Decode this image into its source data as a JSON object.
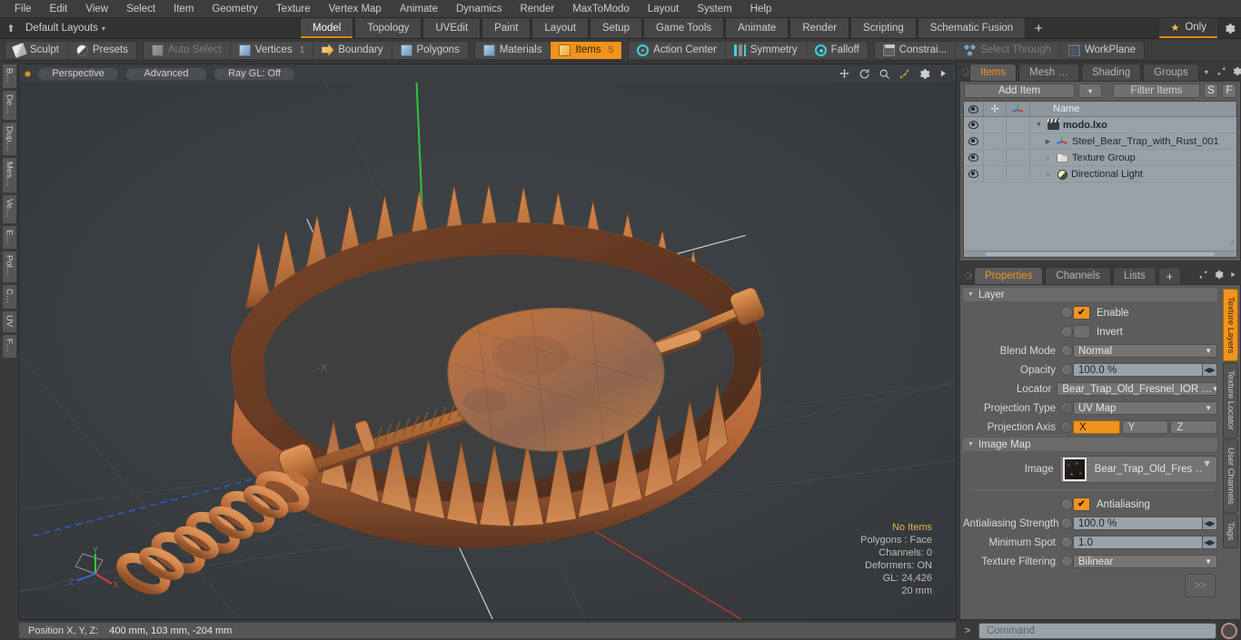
{
  "menubar": {
    "items": [
      "File",
      "Edit",
      "View",
      "Select",
      "Item",
      "Geometry",
      "Texture",
      "Vertex Map",
      "Animate",
      "Dynamics",
      "Render",
      "MaxToModo",
      "Layout",
      "System",
      "Help"
    ]
  },
  "layoutbar": {
    "layouts_label": "Default Layouts",
    "caret": "▾",
    "tabs": [
      {
        "label": "Model",
        "active": true
      },
      {
        "label": "Topology",
        "active": false
      },
      {
        "label": "UVEdit",
        "active": false
      },
      {
        "label": "Paint",
        "active": false
      },
      {
        "label": "Layout",
        "active": false
      },
      {
        "label": "Setup",
        "active": false
      },
      {
        "label": "Game Tools",
        "active": false
      },
      {
        "label": "Animate",
        "active": false
      },
      {
        "label": "Render",
        "active": false
      },
      {
        "label": "Scripting",
        "active": false
      },
      {
        "label": "Schematic Fusion",
        "active": false
      }
    ],
    "add_tab": "+",
    "only_label": "Only",
    "star": "★",
    "gear": "✷"
  },
  "modebar": {
    "group1": [
      {
        "label": "Sculpt",
        "icon": "pen-icon",
        "state": "normal",
        "count": ""
      },
      {
        "label": "Presets",
        "icon": "sphere-icon",
        "state": "normal",
        "count": ""
      }
    ],
    "group2": [
      {
        "label": "Auto Select",
        "icon": "cube-grey-icon",
        "state": "dim",
        "count": ""
      },
      {
        "label": "Vertices",
        "icon": "cube-icon",
        "state": "normal",
        "count": "1"
      },
      {
        "label": "Boundary",
        "icon": "arrow-icon",
        "state": "normal",
        "count": ""
      },
      {
        "label": "Polygons",
        "icon": "cube-icon",
        "state": "normal",
        "count": ""
      }
    ],
    "group3": [
      {
        "label": "Materials",
        "icon": "cube-icon",
        "state": "normal",
        "count": ""
      },
      {
        "label": "Items",
        "icon": "cube-gold-icon",
        "state": "selected",
        "count": "5"
      }
    ],
    "group4": [
      {
        "label": "Action Center",
        "icon": "target-icon",
        "state": "normal",
        "count": ""
      },
      {
        "label": "Symmetry",
        "icon": "symmetry-icon",
        "state": "normal",
        "count": ""
      },
      {
        "label": "Falloff",
        "icon": "falloff-icon",
        "state": "normal",
        "count": ""
      }
    ],
    "group5": [
      {
        "label": "Constrai...",
        "icon": "constrain-icon",
        "state": "normal",
        "count": ""
      },
      {
        "label": "Select Through",
        "icon": "select-through-icon",
        "state": "dim",
        "count": ""
      },
      {
        "label": "WorkPlane",
        "icon": "workplane-icon",
        "state": "normal",
        "count": ""
      }
    ]
  },
  "left_tabs": [
    "B…",
    "De…",
    "Dup…",
    "Mes…",
    "Ve…",
    "E…",
    "Pol…",
    "C…",
    "UV",
    "F…"
  ],
  "viewport": {
    "buttons": [
      "Perspective",
      "Advanced",
      "Ray GL: Off"
    ],
    "icons": [
      "move-icon",
      "rotate-icon",
      "zoom-icon",
      "maximize-icon",
      "gear-icon",
      "play-icon"
    ],
    "info": {
      "selection": "No Items",
      "polygons": "Polygons : Face",
      "channels": "Channels: 0",
      "deformers": "Deformers: ON",
      "gl": "GL: 24,426",
      "scale": "20 mm"
    },
    "gizmo_axes": [
      "X",
      "Y",
      "Z"
    ]
  },
  "statusbar": {
    "position_label": "Position X, Y, Z:",
    "position_value": "400 mm, 103 mm, -204 mm"
  },
  "items_panel": {
    "tabs": [
      {
        "label": "Items",
        "active": true
      },
      {
        "label": "Mesh …",
        "active": false
      },
      {
        "label": "Shading",
        "active": false
      },
      {
        "label": "Groups",
        "active": false
      }
    ],
    "tab_caret": "▾",
    "toolbar": {
      "add_item": "Add Item",
      "add_item_caret": "▾",
      "filter": "Filter Items",
      "btn_s": "S",
      "btn_f": "F"
    },
    "columns": {
      "eye": "eye-icon",
      "add": "+",
      "axis": "axis-icon",
      "name": "Name"
    },
    "rows": [
      {
        "name": "modo.lxo",
        "icon": "clapper-icon",
        "depth": 0,
        "bold": true,
        "expander": "▼"
      },
      {
        "name": "Steel_Bear_Trap_with_Rust_001",
        "icon": "axis-icon",
        "depth": 1,
        "bold": false,
        "expander": "▶"
      },
      {
        "name": "Texture Group",
        "icon": "folder-icon",
        "depth": 1,
        "bold": false,
        "expander": "▪"
      },
      {
        "name": "Directional Light",
        "icon": "light-icon",
        "depth": 1,
        "bold": false,
        "expander": "▪"
      }
    ]
  },
  "properties_panel": {
    "tabs": [
      {
        "label": "Properties",
        "active": true
      },
      {
        "label": "Channels",
        "active": false
      },
      {
        "label": "Lists",
        "active": false
      },
      {
        "label": "+",
        "active": false
      }
    ],
    "layer_section": {
      "title": "Layer",
      "enable_label": "Enable",
      "enable_checked": true,
      "invert_label": "Invert",
      "invert_checked": false,
      "blend_mode_label": "Blend Mode",
      "blend_mode_value": "Normal",
      "opacity_label": "Opacity",
      "opacity_value": "100.0 %",
      "locator_label": "Locator",
      "locator_value": "Bear_Trap_Old_Fresnel_IOR …",
      "projection_type_label": "Projection Type",
      "projection_type_value": "UV Map",
      "projection_axis_label": "Projection Axis",
      "projection_axis_options": [
        "X",
        "Y",
        "Z"
      ],
      "projection_axis_selected": "X"
    },
    "image_map_section": {
      "title": "Image Map",
      "image_label": "Image",
      "image_value": "Bear_Trap_Old_Fres …",
      "antialiasing_label": "Antialiasing",
      "antialiasing_checked": true,
      "aa_strength_label": "Antialiasing Strength",
      "aa_strength_value": "100.0 %",
      "min_spot_label": "Minimum Spot",
      "min_spot_value": "1.0",
      "texture_filtering_label": "Texture Filtering",
      "texture_filtering_value": "Bilinear",
      "more_button": ">>"
    }
  },
  "right_tabs": [
    {
      "label": "Texture Layers",
      "active": true
    },
    {
      "label": "Texture Locator",
      "active": false
    },
    {
      "label": "User Channels",
      "active": false
    },
    {
      "label": "Tags",
      "active": false
    }
  ],
  "command_bar": {
    "caret": ">",
    "placeholder": "Command",
    "record": "record-icon"
  },
  "colors": {
    "accent": "#f0941d",
    "panel": "#5c5c5c",
    "chrome": "#3a3a3a",
    "list_bg": "#98a0a8",
    "viewport_bg": "#393d40",
    "model": "#c8703a"
  }
}
